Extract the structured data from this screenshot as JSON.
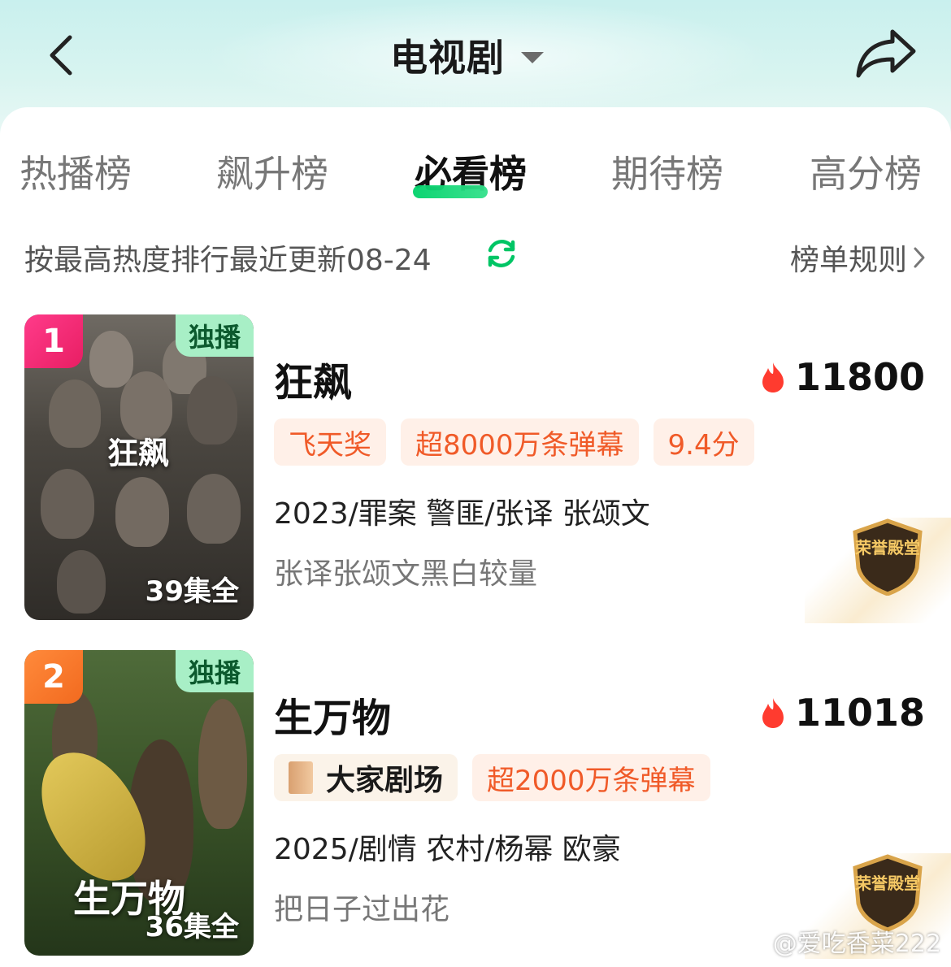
{
  "header": {
    "title": "电视剧"
  },
  "tabs": [
    {
      "label": "热播榜"
    },
    {
      "label": "飙升榜"
    },
    {
      "label": "必看榜"
    },
    {
      "label": "期待榜"
    },
    {
      "label": "高分榜"
    }
  ],
  "active_tab": "必看榜",
  "subline": {
    "sort_text": "按最高热度排行最近更新08-24",
    "rules_label": "榜单规则"
  },
  "items": [
    {
      "rank": "1",
      "exclusive_badge": "独播",
      "episodes": "39集全",
      "poster_title": "狂飙",
      "title": "狂飙",
      "heat": "11800",
      "tags": [
        "飞天奖",
        "超8000万条弹幕",
        "9.4分"
      ],
      "meta": "2023/罪案 警匪/张译 张颂文",
      "desc": "张译张颂文黑白较量",
      "honor_badge": "荣誉殿堂"
    },
    {
      "rank": "2",
      "exclusive_badge": "独播",
      "episodes": "36集全",
      "poster_title": "生万物",
      "title": "生万物",
      "heat": "11018",
      "brand_tag": "大家剧场",
      "tags": [
        "超2000万条弹幕"
      ],
      "meta": "2025/剧情 农村/杨幂 欧豪",
      "desc": "把日子过出花",
      "honor_badge": "荣誉殿堂"
    }
  ],
  "watermark": "@爱吃香菜222",
  "colors": {
    "accent_green": "#00d26a",
    "heat_red": "#ff3b2f",
    "tag_orange": "#f05a28",
    "rank1": "#e81e63",
    "rank2": "#f26a1f"
  }
}
